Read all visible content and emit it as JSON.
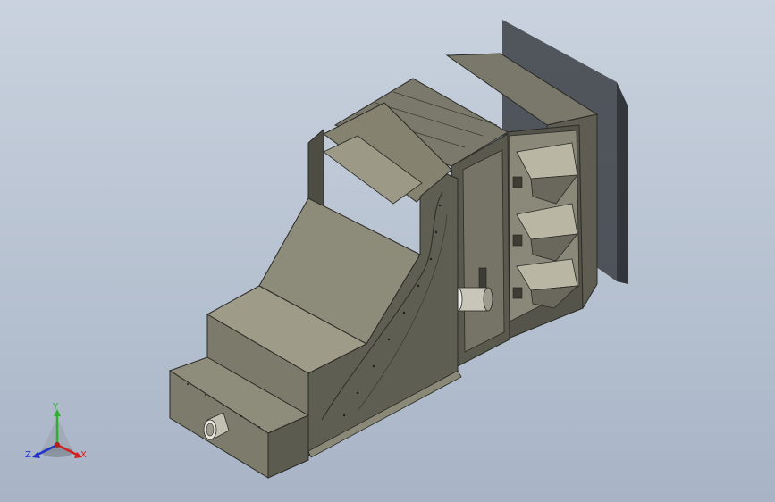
{
  "viewport": {
    "background_top": "#c9d2de",
    "background_bottom": "#a8b4c6",
    "model": {
      "part_color": "#6d6b5e",
      "edge_color": "#2a2a26",
      "shadow_color": "#3c3f45"
    }
  },
  "triad": {
    "axes": [
      {
        "id": "y",
        "label": "Y",
        "color": "#2eaf2e",
        "icon": "y-axis-arrow"
      },
      {
        "id": "z",
        "label": "Z",
        "color": "#2233cc",
        "icon": "z-axis-arrow"
      },
      {
        "id": "x",
        "label": "X",
        "color": "#d42020",
        "icon": "x-axis-arrow"
      }
    ]
  }
}
